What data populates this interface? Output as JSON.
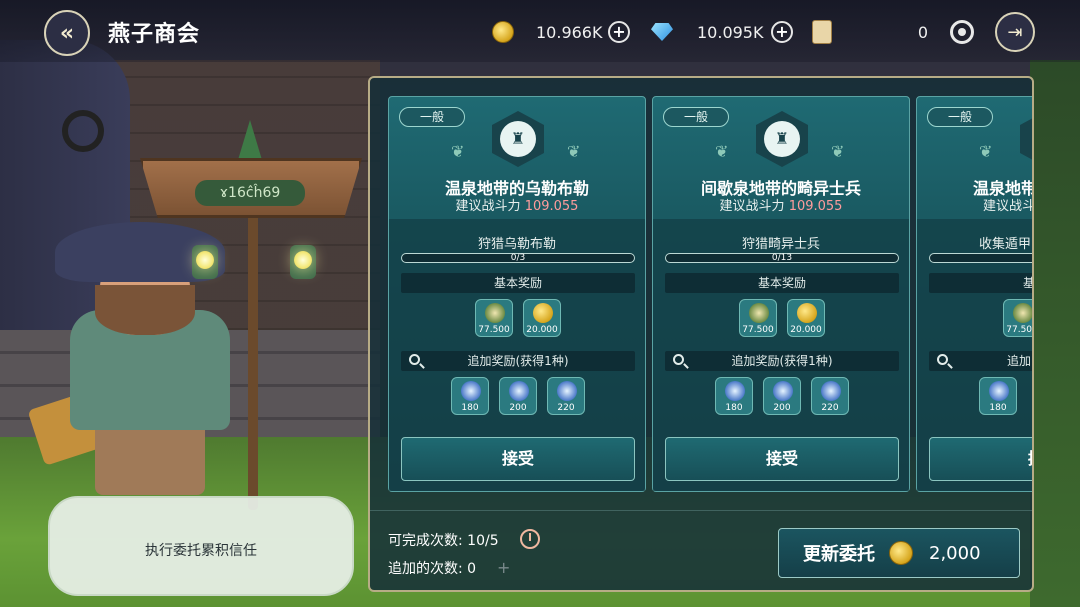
{
  "header": {
    "title": "燕子商会",
    "gold": "10.966K",
    "diamonds": "10.095K",
    "tickets": "0"
  },
  "cards": [
    {
      "grade": "一般",
      "title": "温泉地带的乌勒布勒",
      "power_label": "建议战斗力",
      "power_value": "109.055",
      "task": "狩猎乌勒布勒",
      "progress_text": "0/3",
      "progress": 0,
      "basic_reward_label": "基本奖励",
      "basic_rewards": [
        {
          "icon": "exp-icon",
          "qty": "77.500"
        },
        {
          "icon": "gold-coin-icon",
          "qty": "20.000"
        }
      ],
      "extra_reward_label": "追加奖励(获得1种)",
      "extra_rewards": [
        {
          "icon": "orb-icon",
          "qty": "180"
        },
        {
          "icon": "orb-icon",
          "qty": "200"
        },
        {
          "icon": "orb-icon",
          "qty": "220"
        }
      ],
      "accept_label": "接受"
    },
    {
      "grade": "一般",
      "title": "间歇泉地带的畸异士兵",
      "power_label": "建议战斗力",
      "power_value": "109.055",
      "task": "狩猎畸异士兵",
      "progress_text": "0/13",
      "progress": 0,
      "basic_reward_label": "基本奖励",
      "basic_rewards": [
        {
          "icon": "exp-icon",
          "qty": "77.500"
        },
        {
          "icon": "gold-coin-icon",
          "qty": "20.000"
        }
      ],
      "extra_reward_label": "追加奖励(获得1种)",
      "extra_rewards": [
        {
          "icon": "orb-icon",
          "qty": "180"
        },
        {
          "icon": "orb-icon",
          "qty": "200"
        },
        {
          "icon": "orb-icon",
          "qty": "220"
        }
      ],
      "accept_label": "接受"
    },
    {
      "grade": "一般",
      "title": "温泉地带",
      "power_label": "建议战斗",
      "task": "收集遁甲",
      "basic_reward_label": "基",
      "basic_rewards": [
        {
          "icon": "exp-icon",
          "qty": "77.500"
        }
      ],
      "extra_reward_label": "追加",
      "extra_rewards": [
        {
          "icon": "orb-icon",
          "qty": "180"
        }
      ],
      "accept_label": "接"
    }
  ],
  "footer": {
    "available_label": "可完成次数:",
    "available_value": "10/5",
    "added_label": "追加的次数:",
    "added_value": "0",
    "refresh_label": "更新委托",
    "refresh_cost": "2,000"
  },
  "npc": {
    "sign_text": "ɤ16ĉĥ69",
    "bubble_text": "执行委托累积信任"
  },
  "colors": {
    "panel_border": "#b7ac86",
    "power_value": "#ff9c9c",
    "card_bg": "#1f6a73"
  }
}
